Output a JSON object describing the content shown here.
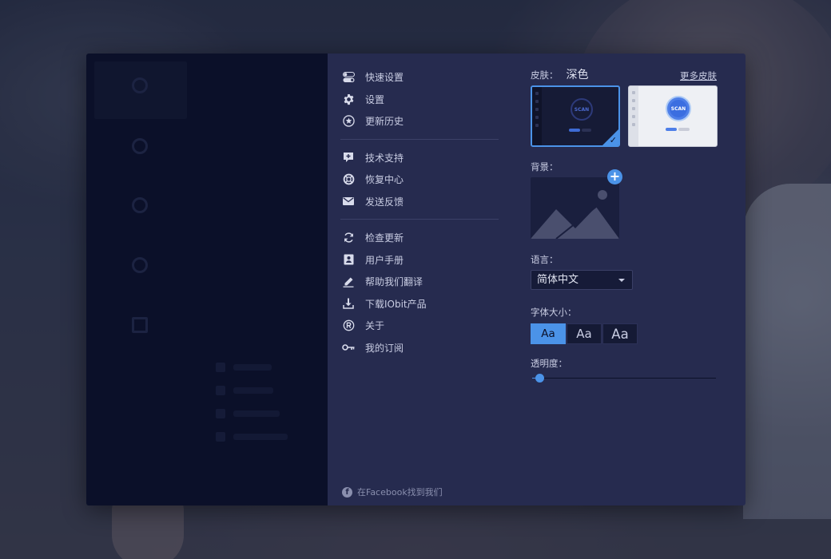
{
  "menu": {
    "groups": [
      [
        {
          "label": "快速设置",
          "icon": "toggle-icon"
        },
        {
          "label": "设置",
          "icon": "gear-icon"
        },
        {
          "label": "更新历史",
          "icon": "star-circle-icon"
        }
      ],
      [
        {
          "label": "技术支持",
          "icon": "support-chat-icon"
        },
        {
          "label": "恢复中心",
          "icon": "lifebuoy-icon"
        },
        {
          "label": "发送反馈",
          "icon": "envelope-icon"
        }
      ],
      [
        {
          "label": "检查更新",
          "icon": "refresh-icon"
        },
        {
          "label": "用户手册",
          "icon": "manual-book-icon"
        },
        {
          "label": "帮助我们翻译",
          "icon": "pen-icon"
        },
        {
          "label": "下载IObit产品",
          "icon": "download-icon"
        },
        {
          "label": "关于",
          "icon": "registered-icon"
        },
        {
          "label": "我的订阅",
          "icon": "key-icon"
        }
      ]
    ],
    "facebook": "在Facebook找到我们"
  },
  "settings": {
    "skin_label": "皮肤：",
    "skin_value": "深色",
    "more_skins": "更多皮肤",
    "skins": [
      {
        "name": "dark",
        "selected": true,
        "scan_text": "SCAN"
      },
      {
        "name": "light",
        "selected": false,
        "scan_text": "SCAN"
      }
    ],
    "background_label": "背景：",
    "language_label": "语言：",
    "language_value": "简体中文",
    "font_size_label": "字体大小：",
    "font_sizes": [
      "Aa",
      "Aa",
      "Aa"
    ],
    "font_size_selected_index": 0,
    "opacity_label": "透明度：",
    "opacity_value": 0.02
  },
  "colors": {
    "accent": "#4b93e8",
    "panel": "#262b4f",
    "sidebar": "#0b1029"
  }
}
